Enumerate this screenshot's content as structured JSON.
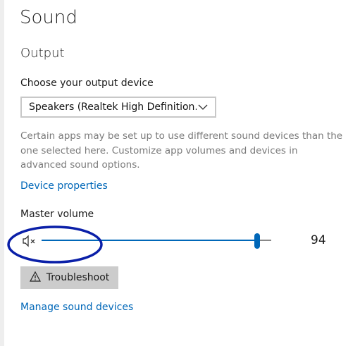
{
  "page": {
    "title": "Sound"
  },
  "output": {
    "heading": "Output",
    "device_label": "Choose your output device",
    "device_selected": "Speakers (Realtek High Definition...",
    "description": "Certain apps may be set up to use different sound devices than the one selected here. Customize app volumes and devices in advanced sound options.",
    "device_properties_link": "Device properties",
    "master_volume_label": "Master volume",
    "volume_value": "94",
    "volume_level": 0.94,
    "troubleshoot_label": "Troubleshoot",
    "manage_devices_link": "Manage sound devices"
  },
  "icons": {
    "speaker_muted": "speaker-muted-icon",
    "chevron": "chevron-down-icon",
    "warning": "warning-icon"
  },
  "colors": {
    "accent": "#0067b8",
    "description_text": "#7a7a7a",
    "button_bg": "#cccccc",
    "annotation_ellipse": "#0a1fa8"
  }
}
